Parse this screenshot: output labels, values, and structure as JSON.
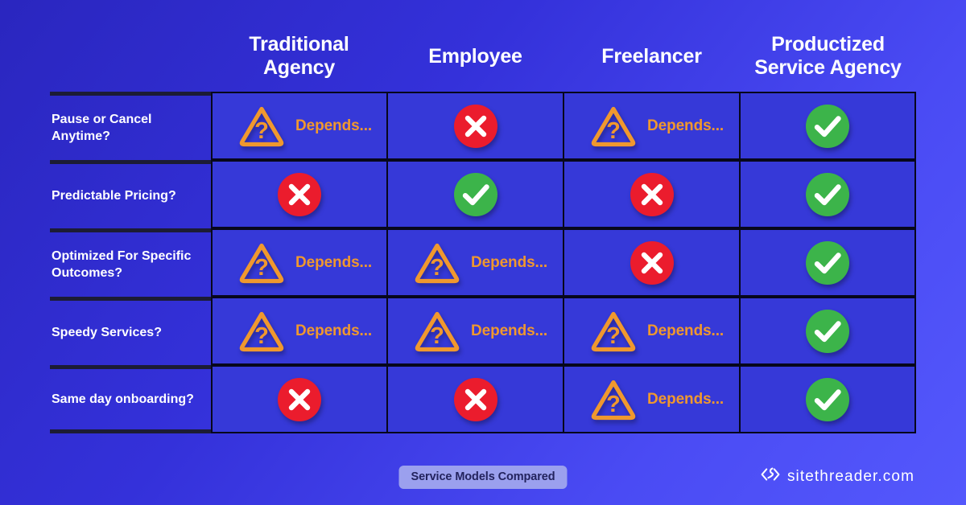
{
  "theme": {
    "bg_gradient_from": "#2a26bf",
    "bg_gradient_to": "#5458fc",
    "cell_bg": "#3639d8",
    "grid_line": "#07071c",
    "label_rule": "#1c1c35",
    "yes_color": "#3cb44a",
    "no_color": "#eb1c2d",
    "depends_color": "#f0982e",
    "badge_bg": "#9ba0ee",
    "badge_text": "#23235e"
  },
  "table": {
    "corner_label": "",
    "columns": [
      "Traditional Agency",
      "Employee",
      "Freelancer",
      "Productized Service Agency"
    ],
    "rows": [
      {
        "label": "Pause or Cancel Anytime?",
        "values": [
          "depends",
          "no",
          "depends",
          "yes"
        ],
        "value_labels": [
          "Depends...",
          "",
          "Depends...",
          ""
        ]
      },
      {
        "label": "Predictable Pricing?",
        "values": [
          "no",
          "yes",
          "no",
          "yes"
        ],
        "value_labels": [
          "",
          "",
          "",
          ""
        ]
      },
      {
        "label": "Optimized For Specific Outcomes?",
        "values": [
          "depends",
          "depends",
          "no",
          "yes"
        ],
        "value_labels": [
          "Depends...",
          "Depends...",
          "",
          ""
        ]
      },
      {
        "label": "Speedy Services?",
        "values": [
          "depends",
          "depends",
          "depends",
          "yes"
        ],
        "value_labels": [
          "Depends...",
          "Depends...",
          "Depends...",
          ""
        ]
      },
      {
        "label": "Same day onboarding?",
        "values": [
          "no",
          "no",
          "depends",
          "yes"
        ],
        "value_labels": [
          "",
          "",
          "Depends...",
          ""
        ]
      }
    ]
  },
  "footer": {
    "badge_label": "Service Models Compared",
    "logo_icon": "code-brackets-icon",
    "logo_text": "sitethreader.com"
  }
}
